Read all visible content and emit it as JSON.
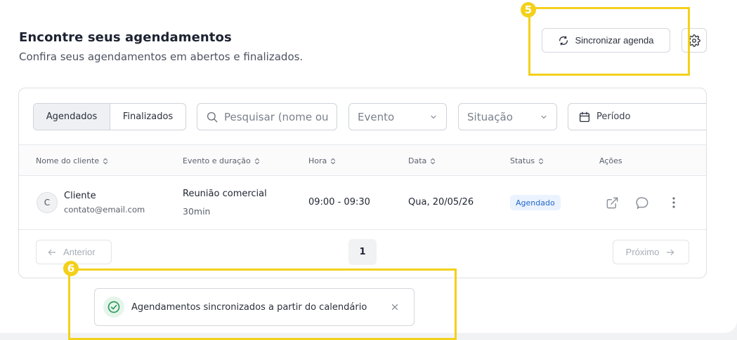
{
  "header": {
    "title": "Encontre seus agendamentos",
    "subtitle": "Confira seus agendamentos em abertos e finalizados.",
    "sync_label": "Sincronizar agenda"
  },
  "markers": {
    "first": "5",
    "second": "6"
  },
  "filters": {
    "tabs": [
      {
        "label": "Agendados",
        "active": true
      },
      {
        "label": "Finalizados",
        "active": false
      }
    ],
    "search_placeholder": "Pesquisar (nome ou",
    "event_label": "Evento",
    "status_label": "Situação",
    "period_label": "Período"
  },
  "table": {
    "columns": [
      "Nome do cliente",
      "Evento e duração",
      "Hora",
      "Data",
      "Status",
      "Ações"
    ],
    "rows": [
      {
        "avatar_initial": "C",
        "client_name": "Cliente",
        "client_email": "contato@email.com",
        "event": "Reunião comercial",
        "duration": "30min",
        "time": "09:00 - 09:30",
        "date": "Qua, 20/05/26",
        "status": "Agendado"
      }
    ]
  },
  "pagination": {
    "prev_label": "Anterior",
    "current_page": "1",
    "next_label": "Próximo"
  },
  "toast": {
    "message": "Agendamentos sincronizados a partir do calendário"
  },
  "colors": {
    "accent_highlight": "#f3d11b",
    "status_badge_bg": "#eaf3ff",
    "status_badge_text": "#2467c6",
    "success": "#2e9a5a"
  },
  "icons": {
    "sync": "sync-icon",
    "settings": "gear-icon",
    "search": "search-icon",
    "calendar": "calendar-icon",
    "open": "external-link-icon",
    "chat": "chat-icon",
    "more": "more-vertical-icon",
    "success": "check-circle-icon",
    "close": "close-icon"
  }
}
